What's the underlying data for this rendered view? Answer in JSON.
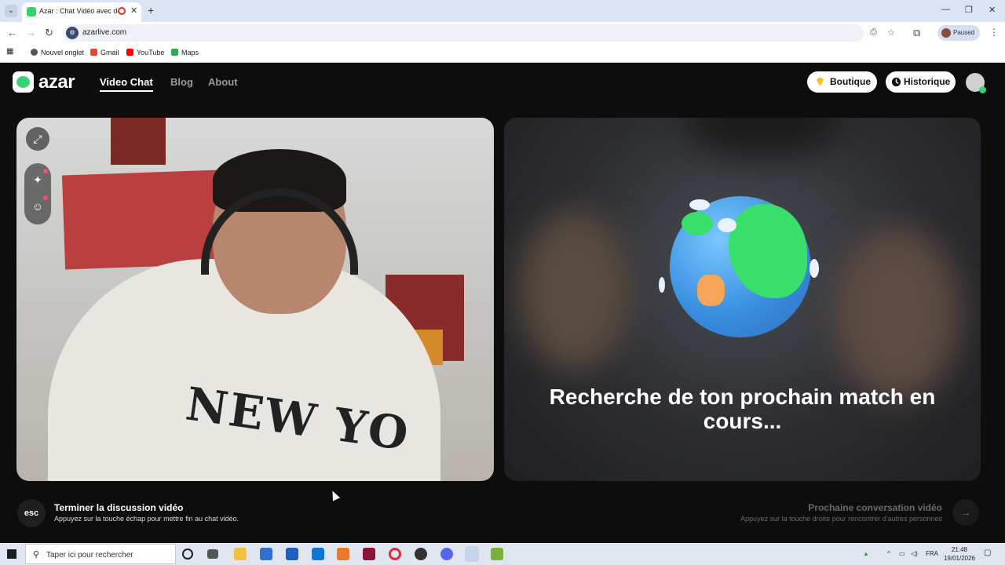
{
  "browser": {
    "tab_title": "Azar : Chat Vidéo avec de n",
    "new_tab": "+",
    "url": "azarlive.com",
    "profile_status": "Paused",
    "bookmarks": [
      "Nouvel onglet",
      "Gmail",
      "YouTube",
      "Maps"
    ]
  },
  "site": {
    "logo": "azar",
    "nav": [
      "Video Chat",
      "Blog",
      "About"
    ],
    "shop_label": "Boutique",
    "history_label": "Historique",
    "search_status": "Recherche de ton prochain match en cours...",
    "shirt_text": "NEW YO",
    "end_key": "esc",
    "end_title": "Terminer la discussion vidéo",
    "end_sub": "Appuyez sur la touche échap pour mettre fin au chat vidéo.",
    "next_title": "Prochaine conversation vidéo",
    "next_sub": "Appuyez sur la touche droite pour rencontrer d'autres personnes",
    "accent_color": "#3ad17b"
  },
  "taskbar": {
    "search_placeholder": "Taper ici pour rechercher",
    "language": "FRA",
    "time": "21:48",
    "date": "19/01/2026"
  }
}
